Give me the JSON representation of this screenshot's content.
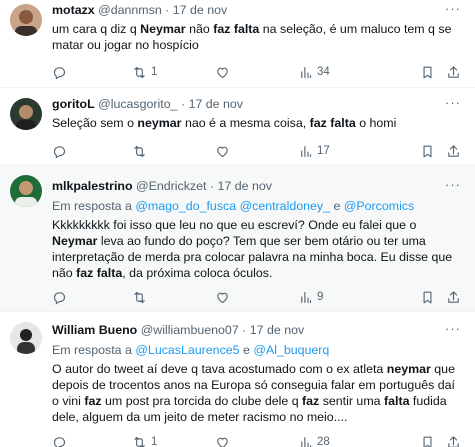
{
  "tweets": [
    {
      "name": "motazx",
      "handle": "@dannmsn",
      "sep": "·",
      "date": "17 de nov",
      "more": "···",
      "reply_prefix": "",
      "reply_handles": [],
      "segments": [
        {
          "t": "um cara q diz q "
        },
        {
          "t": "Neymar",
          "b": true
        },
        {
          "t": " não "
        },
        {
          "t": "faz falta",
          "b": true
        },
        {
          "t": " na seleção, é um maluco tem q se matar ou jogar no hospício"
        }
      ],
      "replies": "",
      "retweets": "1",
      "likes": "",
      "views": "34"
    },
    {
      "name": "goritoL",
      "handle": "@lucasgorito_",
      "sep": "·",
      "date": "17 de nov",
      "more": "···",
      "reply_prefix": "",
      "reply_handles": [],
      "segments": [
        {
          "t": "Seleção sem o "
        },
        {
          "t": "neymar",
          "b": true
        },
        {
          "t": " nao é a mesma coisa, "
        },
        {
          "t": "faz falta",
          "b": true
        },
        {
          "t": " o homi"
        }
      ],
      "replies": "",
      "retweets": "",
      "likes": "",
      "views": "17"
    },
    {
      "name": "mlkpalestrino",
      "handle": "@Endrickzet",
      "sep": "·",
      "date": "17 de nov",
      "more": "···",
      "reply_prefix": "Em resposta a ",
      "reply_handles": [
        "@mago_do_fusca",
        "@centraldoney_",
        "e",
        "@Porcomics"
      ],
      "segments": [
        {
          "t": "Kkkkkkkkk foi isso que leu no que eu escreví? Onde eu falei que o "
        },
        {
          "t": "Neymar",
          "b": true
        },
        {
          "t": " leva ao fundo do poço? Tem que ser bem otário ou ter uma interpretação de merda pra colocar palavra na minha boca. Eu disse que não "
        },
        {
          "t": "faz falta",
          "b": true
        },
        {
          "t": ", da próxima coloca óculos."
        }
      ],
      "replies": "",
      "retweets": "",
      "likes": "",
      "views": "9"
    },
    {
      "name": "William Bueno",
      "handle": "@williambueno07",
      "sep": "·",
      "date": "17 de nov",
      "more": "···",
      "reply_prefix": "Em resposta a ",
      "reply_handles": [
        "@LucasLaurence5",
        "e",
        "@Al_buquerq"
      ],
      "segments": [
        {
          "t": "O autor do tweet aí deve q tava acostumado com o ex atleta "
        },
        {
          "t": "neymar",
          "b": true
        },
        {
          "t": " que depois de trocentos anos na Europa só conseguia falar em português daí o vini "
        },
        {
          "t": "faz",
          "b": true
        },
        {
          "t": " um post pra torcida do clube dele q "
        },
        {
          "t": "faz",
          "b": true
        },
        {
          "t": " sentir uma "
        },
        {
          "t": "falta",
          "b": true
        },
        {
          "t": " fudida dele, alguem da um jeito de meter racismo no meio...."
        }
      ],
      "replies": "",
      "retweets": "1",
      "likes": "",
      "views": "28"
    }
  ],
  "icons": {
    "reply": "reply-icon",
    "retweet": "retweet-icon",
    "like": "heart-icon",
    "views": "views-chart-icon",
    "bookmark": "bookmark-icon",
    "share": "share-icon"
  },
  "colors": {
    "accent": "#1d9bf0",
    "muted": "#536471",
    "text": "#0f1419",
    "highlight_bg": "#f7f9f9"
  }
}
